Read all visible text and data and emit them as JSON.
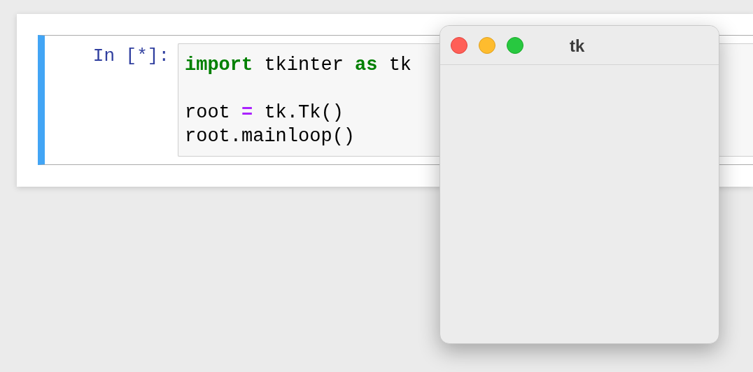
{
  "cell": {
    "prompt": "In [*]:",
    "selected": true,
    "lines": [
      {
        "kind": "code",
        "tokens": [
          {
            "kind": "keyword",
            "text": "import"
          },
          {
            "kind": "plain",
            "text": " tkinter "
          },
          {
            "kind": "keyword",
            "text": "as"
          },
          {
            "kind": "plain",
            "text": " tk"
          }
        ]
      },
      {
        "kind": "blank"
      },
      {
        "kind": "code",
        "tokens": [
          {
            "kind": "plain",
            "text": "root "
          },
          {
            "kind": "operator",
            "text": "="
          },
          {
            "kind": "plain",
            "text": " tk.Tk()"
          }
        ]
      },
      {
        "kind": "code",
        "tokens": [
          {
            "kind": "plain",
            "text": "root.mainloop()"
          }
        ]
      }
    ]
  },
  "tk_window": {
    "title": "tk"
  }
}
